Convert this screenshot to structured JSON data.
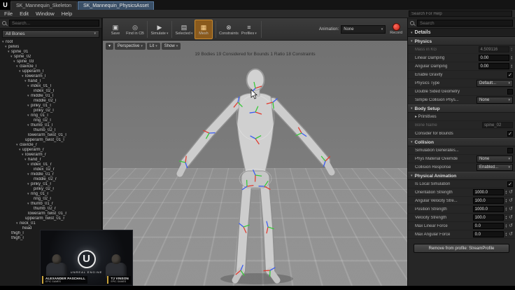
{
  "titlebar": {
    "tabs": [
      {
        "label": "SK_Mannequin_Skeleton"
      },
      {
        "label": "SK_Mannequin_PhysicsAsset"
      }
    ]
  },
  "menubar": {
    "items": [
      "File",
      "Edit",
      "Window",
      "Help"
    ],
    "search_placeholder": "Search For Help"
  },
  "toolbar": {
    "buttons": [
      {
        "label": "Save",
        "icon": "▣"
      },
      {
        "label": "Find in CB",
        "icon": "◎"
      },
      {
        "sep": true
      },
      {
        "label": "Simulate",
        "icon": "▶",
        "caret": true
      },
      {
        "sep": true
      },
      {
        "label": "Selected",
        "icon": "▤",
        "caret": true
      },
      {
        "label": "Mesh",
        "icon": "▦",
        "active": true
      },
      {
        "sep": true
      },
      {
        "label": "Constraints",
        "icon": "⊗"
      },
      {
        "label": "Profiles",
        "icon": "≡",
        "caret": true
      },
      {
        "sep": true
      }
    ],
    "animation_label": "Animation:",
    "animation_value": "None",
    "record_label": "Record"
  },
  "skeleton": {
    "search_placeholder": "Search...",
    "filter_label": "All Bones",
    "items": [
      {
        "level": 0,
        "label": "root"
      },
      {
        "level": 1,
        "label": "pelvis"
      },
      {
        "level": 2,
        "label": "spine_01"
      },
      {
        "level": 3,
        "label": "spine_02"
      },
      {
        "level": 4,
        "label": "spine_03"
      },
      {
        "level": 5,
        "label": "clavicle_l"
      },
      {
        "level": 6,
        "label": "upperarm_l"
      },
      {
        "level": 7,
        "label": "lowerarm_l"
      },
      {
        "level": 8,
        "label": "hand_l"
      },
      {
        "level": 9,
        "label": "index_01_l"
      },
      {
        "level": 10,
        "label": "index_02_l"
      },
      {
        "level": 9,
        "label": "middle_01_l"
      },
      {
        "level": 10,
        "label": "middle_02_l"
      },
      {
        "level": 9,
        "label": "pinky_01_l"
      },
      {
        "level": 10,
        "label": "pinky_02_l"
      },
      {
        "level": 9,
        "label": "ring_01_l"
      },
      {
        "level": 10,
        "label": "ring_02_l"
      },
      {
        "level": 9,
        "label": "thumb_01_l"
      },
      {
        "level": 10,
        "label": "thumb_02_l"
      },
      {
        "level": 8,
        "label": "lowerarm_twist_01_l"
      },
      {
        "level": 7,
        "label": "upperarm_twist_01_l"
      },
      {
        "level": 5,
        "label": "clavicle_r"
      },
      {
        "level": 6,
        "label": "upperarm_r"
      },
      {
        "level": 7,
        "label": "lowerarm_r"
      },
      {
        "level": 8,
        "label": "hand_r"
      },
      {
        "level": 9,
        "label": "index_01_r"
      },
      {
        "level": 10,
        "label": "index_02_r"
      },
      {
        "level": 9,
        "label": "middle_01_r"
      },
      {
        "level": 10,
        "label": "middle_02_r"
      },
      {
        "level": 9,
        "label": "pinky_01_r"
      },
      {
        "level": 10,
        "label": "pinky_02_r"
      },
      {
        "level": 9,
        "label": "ring_01_r"
      },
      {
        "level": 10,
        "label": "ring_02_r"
      },
      {
        "level": 9,
        "label": "thumb_01_r"
      },
      {
        "level": 10,
        "label": "thumb_02_r"
      },
      {
        "level": 8,
        "label": "lowerarm_twist_01_r"
      },
      {
        "level": 7,
        "label": "upperarm_twist_01_r"
      },
      {
        "level": 5,
        "label": "neck_01"
      },
      {
        "level": 6,
        "label": "head"
      },
      {
        "level": 2,
        "label": "thigh_l"
      },
      {
        "level": 2,
        "label": "thigh_r"
      }
    ]
  },
  "viewport": {
    "chips": [
      {
        "icon": "▾",
        "label": ""
      },
      {
        "label": "Perspective",
        "caret": true
      },
      {
        "label": "Lit",
        "caret": true
      },
      {
        "label": "Show",
        "caret": true
      }
    ],
    "stats": "19 Bodies   19 Considered for Bounds   1 Ratio   18 Constraints"
  },
  "details": {
    "tab_label": "Details",
    "search_placeholder": "Search",
    "sections": [
      {
        "title": "Physics",
        "rows": [
          {
            "label": "Mass in KG",
            "value": "4.509116",
            "type": "number",
            "disabled": true
          },
          {
            "label": "Linear Damping",
            "value": "0.00",
            "type": "number"
          },
          {
            "label": "Angular Damping",
            "value": "0.00",
            "type": "number"
          },
          {
            "label": "Enable Gravity",
            "type": "check",
            "checked": true
          },
          {
            "label": "Physics Type",
            "value": "Default...",
            "type": "dropdown"
          },
          {
            "label": "Double Sided Geometry",
            "type": "check",
            "checked": false
          },
          {
            "label": "Simple Collision Phys...",
            "value": "None",
            "type": "dropdown"
          }
        ]
      },
      {
        "title": "Body Setup",
        "rows": [
          {
            "label": "Primitives",
            "type": "expand"
          },
          {
            "label": "Bone Name",
            "value": "spine_02",
            "type": "text",
            "disabled": true
          },
          {
            "label": "Consider for Bounds",
            "type": "check",
            "checked": true
          }
        ]
      },
      {
        "title": "Collision",
        "rows": [
          {
            "label": "Simulation Generates...",
            "type": "check",
            "checked": false
          },
          {
            "label": "Phys Material Override",
            "value": "None",
            "type": "dropdown"
          },
          {
            "label": "Collision Response",
            "value": "Enabled...",
            "type": "dropdown"
          }
        ]
      },
      {
        "title": "Physical Animation",
        "rows": [
          {
            "label": "Is Local Simulation",
            "type": "check",
            "checked": true
          },
          {
            "label": "Orientation Strength",
            "value": "1000.0",
            "type": "number-reset"
          },
          {
            "label": "Angular Velocity Stre...",
            "value": "100.0",
            "type": "number-reset"
          },
          {
            "label": "Position Strength",
            "value": "1000.0",
            "type": "number-reset"
          },
          {
            "label": "Velocity Strength",
            "value": "100.0",
            "type": "number-reset"
          },
          {
            "label": "Max Linear Force",
            "value": "0.0",
            "type": "number-reset"
          },
          {
            "label": "Max Angular Force",
            "value": "0.0",
            "type": "number-reset"
          }
        ]
      }
    ],
    "remove_button": "Remove from profile: StreamProfile"
  },
  "webcam": {
    "logo_letter": "U",
    "logo_text": "UNREAL ENGINE",
    "left_name": "ALEXANDER PASCHALL",
    "left_role": "EPIC GAMES",
    "right_name": "TJ VINSON",
    "right_role": "EPIC GAMES"
  }
}
